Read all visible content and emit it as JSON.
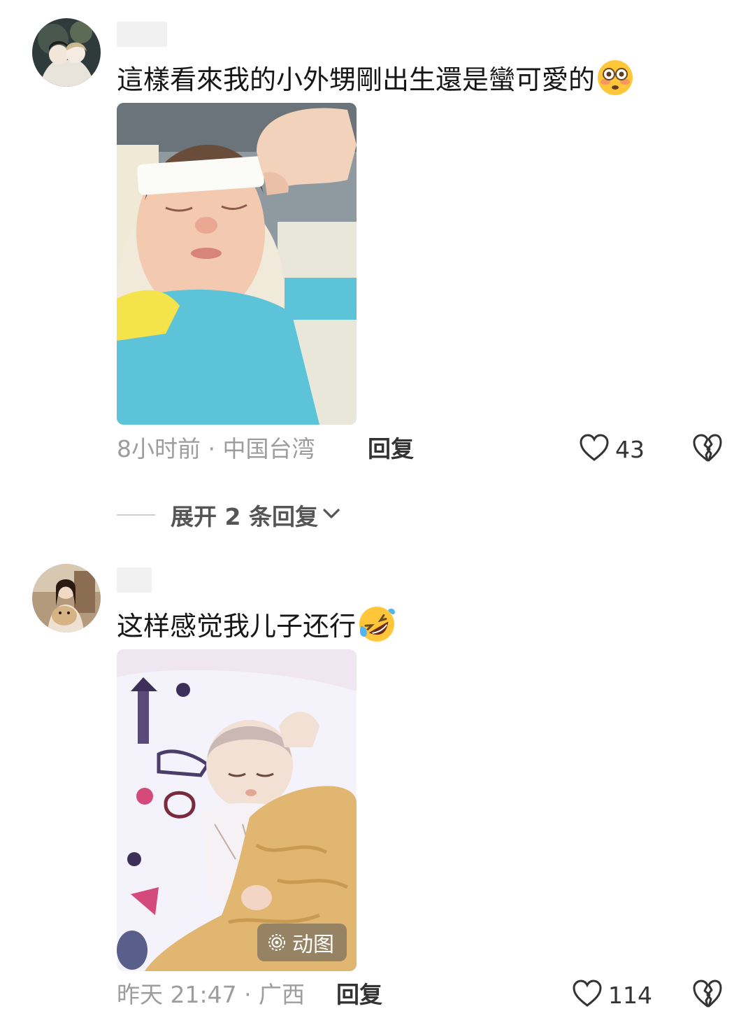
{
  "comments": [
    {
      "text": "這樣看來我的小外甥剛出生還是蠻可愛的",
      "emoji": "flushed-face",
      "time": "8小时前 · 中国台湾",
      "reply_label": "回复",
      "likes": "43",
      "photo_alt": "newborn baby with gauze strip on forehead"
    },
    {
      "text": "这样感觉我儿子还行",
      "emoji": "rolling-on-floor-laughing-face",
      "time": "昨天 21:47 · 广西",
      "reply_label": "回复",
      "likes": "114",
      "gif_label": "动图",
      "photo_alt": "sleeping baby under yellow blanket"
    }
  ],
  "expand_replies": "展开 2 条回复",
  "colors": {
    "text": "#161616",
    "meta": "#9d9d9d",
    "divider": "#cfcfcf"
  }
}
